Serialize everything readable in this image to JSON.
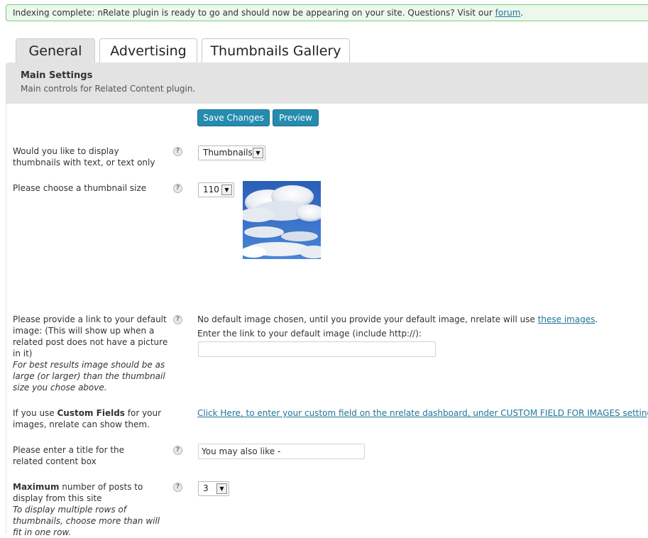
{
  "notice": {
    "text": "Indexing complete: nRelate plugin is ready to go and should now be appearing on your site. Questions? Visit our ",
    "link": "forum",
    "end": "."
  },
  "tabs": [
    {
      "label": "General",
      "active": true
    },
    {
      "label": "Advertising",
      "active": false
    },
    {
      "label": "Thumbnails Gallery",
      "active": false
    }
  ],
  "main": {
    "title": "Main Settings",
    "subtitle": "Main controls for Related Content plugin."
  },
  "buttons": {
    "save": "Save Changes",
    "preview": "Preview"
  },
  "settings": {
    "display": {
      "label": "Would you like to display thumbnails with text, or text only",
      "value": "Thumbnails"
    },
    "thumb_size": {
      "label": "Please choose a thumbnail size",
      "value": "110"
    },
    "default_image": {
      "label": "Please provide a link to your default image: (This will show up when a related post does not have a picture in it)",
      "note": "For best results image should be as large (or larger) than the thumbnail size you chose above.",
      "status_text": "No default image chosen, until you provide your default image, nrelate will use ",
      "status_link": "these images",
      "status_end": ".",
      "field_label": "Enter the link to your default image (include http://):",
      "value": ""
    },
    "custom_fields": {
      "label_pre": "If you use ",
      "label_bold": "Custom Fields",
      "label_post": " for your images, nrelate can show them.",
      "link": "Click Here, to enter your custom field on the nrelate dashboard, under CUSTOM FIELD FOR IMAGES settings. >"
    },
    "title": {
      "label": "Please enter a title for the related content box",
      "value": "You may also like -"
    },
    "max_posts": {
      "label_bold": "Maximum",
      "label_post": " number of posts to display from this site",
      "note": "To display multiple rows of thumbnails, choose more than will fit in one row.",
      "value": "3"
    }
  },
  "icons": {
    "help": "?",
    "dropdown": "▼"
  },
  "colors": {
    "accent": "#258cb0",
    "notice_bg": "#ecf8ec",
    "notice_border": "#7ad07a",
    "header_bg": "#e3e3e3",
    "link": "#21759b"
  }
}
